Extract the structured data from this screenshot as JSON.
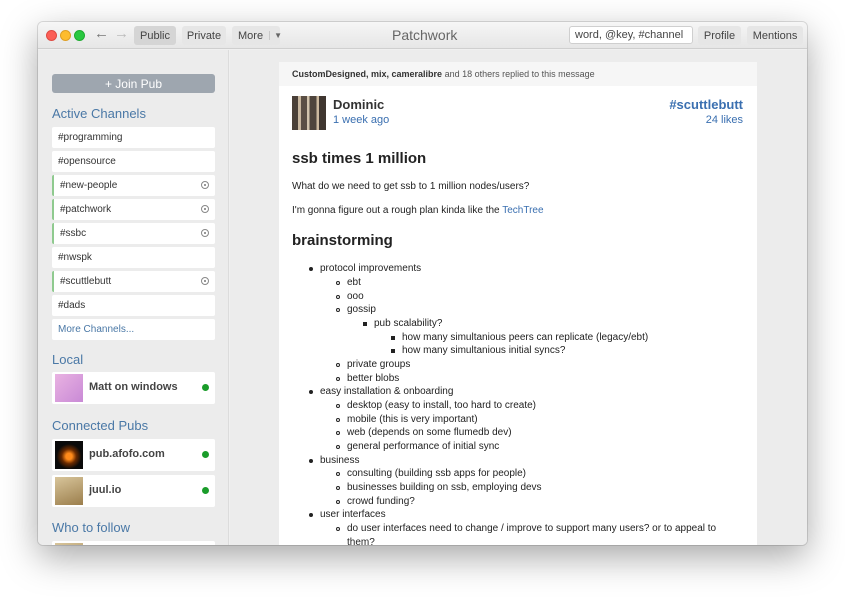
{
  "toolbar": {
    "tabs": [
      "Public",
      "Private",
      "More"
    ],
    "title": "Patchwork",
    "search_value": "word, @key, #channel",
    "profile": "Profile",
    "mentions": "Mentions"
  },
  "sidebar": {
    "join_pub": "+ Join Pub",
    "active_channels_title": "Active Channels",
    "channels": [
      {
        "name": "#programming",
        "subscribed": false
      },
      {
        "name": "#opensource",
        "subscribed": false
      },
      {
        "name": "#new-people",
        "subscribed": true
      },
      {
        "name": "#patchwork",
        "subscribed": true
      },
      {
        "name": "#ssbc",
        "subscribed": true
      },
      {
        "name": "#nwspk",
        "subscribed": false
      },
      {
        "name": "#scuttlebutt",
        "subscribed": true
      },
      {
        "name": "#dads",
        "subscribed": false
      }
    ],
    "more_channels": "More Channels...",
    "local_title": "Local",
    "local": [
      {
        "name": "Matt on windows"
      }
    ],
    "pubs_title": "Connected Pubs",
    "pubs": [
      {
        "name": "pub.afofo.com"
      },
      {
        "name": "juul.io"
      }
    ],
    "follow_title": "Who to follow"
  },
  "message": {
    "replies_names": "CustomDesigned, mix, cameralibre",
    "replies_suffix": " and 18 others replied to this message",
    "author": "Dominic",
    "time": "1 week ago",
    "channel": "#scuttlebutt",
    "likes": "24 likes",
    "heading": "ssb times 1 million",
    "para1": "What do we need to get ssb to 1 million nodes/users?",
    "para2_text": "I'm gonna figure out a rough plan kinda like the ",
    "para2_link": "TechTree",
    "heading2": "brainstorming",
    "list": {
      "protocol": "protocol improvements",
      "ebt": "ebt",
      "ooo": "ooo",
      "gossip": "gossip",
      "pub_scal": "pub scalability?",
      "peers": "how many simultanious peers can replicate (legacy/ebt)",
      "syncs": "how many simultanious initial syncs?",
      "private_groups": "private groups",
      "better_blobs": "better blobs",
      "easy_install": "easy installation & onboarding",
      "desktop": "desktop (easy to install, too hard to create)",
      "mobile": "mobile (this is very important)",
      "web": "web (depends on some flumedb dev)",
      "general": "general performance of initial sync",
      "business": "business",
      "consulting": "consulting (building ssb apps for people)",
      "businesses": "businesses building on ssb, employing devs",
      "crowd": "crowd funding?",
      "ui": "user interfaces",
      "ui_q1": "do user interfaces need to change / improve to support many users? or to appeal to",
      "ui_q2": "them?"
    }
  }
}
